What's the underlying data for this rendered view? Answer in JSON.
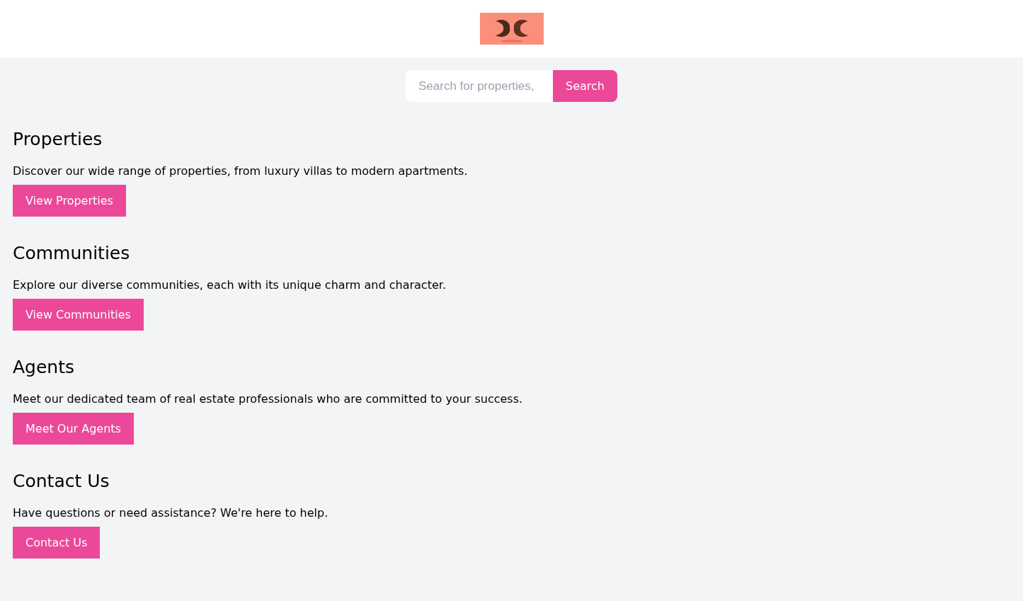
{
  "search": {
    "placeholder": "Search for properties,",
    "button": "Search"
  },
  "sections": [
    {
      "title": "Properties",
      "text": "Discover our wide range of properties, from luxury villas to modern apartments.",
      "button": "View Properties"
    },
    {
      "title": "Communities",
      "text": "Explore our diverse communities, each with its unique charm and character.",
      "button": "View Communities"
    },
    {
      "title": "Agents",
      "text": "Meet our dedicated team of real estate professionals who are committed to your success.",
      "button": "Meet Our Agents"
    },
    {
      "title": "Contact Us",
      "text": "Have questions or need assistance? We're here to help.",
      "button": "Contact Us"
    }
  ]
}
